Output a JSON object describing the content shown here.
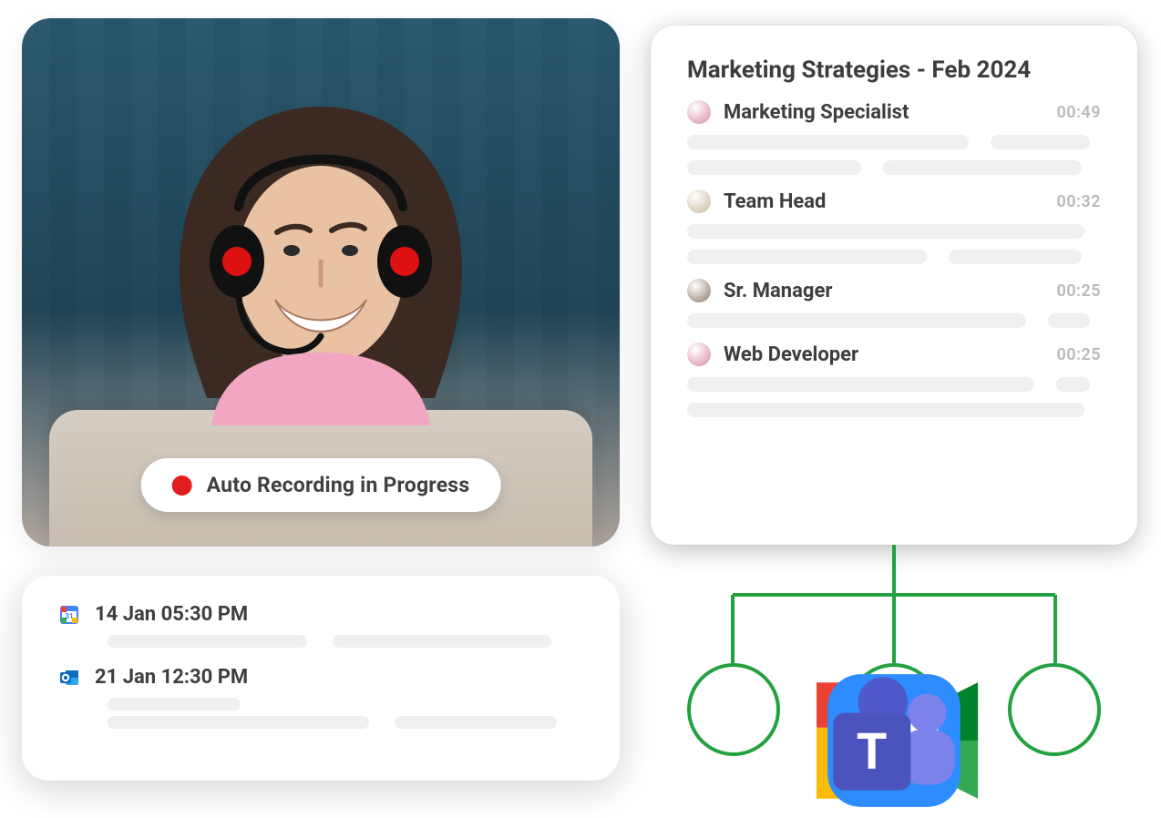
{
  "video": {
    "status_label": "Auto Recording in Progress"
  },
  "calendar": {
    "items": [
      {
        "app": "google-calendar",
        "label": "14 Jan 05:30 PM"
      },
      {
        "app": "outlook",
        "label": "21 Jan 12:30 PM"
      }
    ]
  },
  "transcript": {
    "title": "Marketing Strategies - Feb 2024",
    "speakers": [
      {
        "role": "Marketing Specialist",
        "time": "00:49",
        "avatar": "#d88aa8"
      },
      {
        "role": "Team Head",
        "time": "00:32",
        "avatar": "#c8b89a"
      },
      {
        "role": "Sr. Manager",
        "time": "00:25",
        "avatar": "#8a7866"
      },
      {
        "role": "Web Developer",
        "time": "00:25",
        "avatar": "#d88aa8"
      }
    ]
  },
  "platforms": {
    "items": [
      {
        "id": "google-meet"
      },
      {
        "id": "zoom"
      },
      {
        "id": "microsoft-teams"
      }
    ]
  }
}
